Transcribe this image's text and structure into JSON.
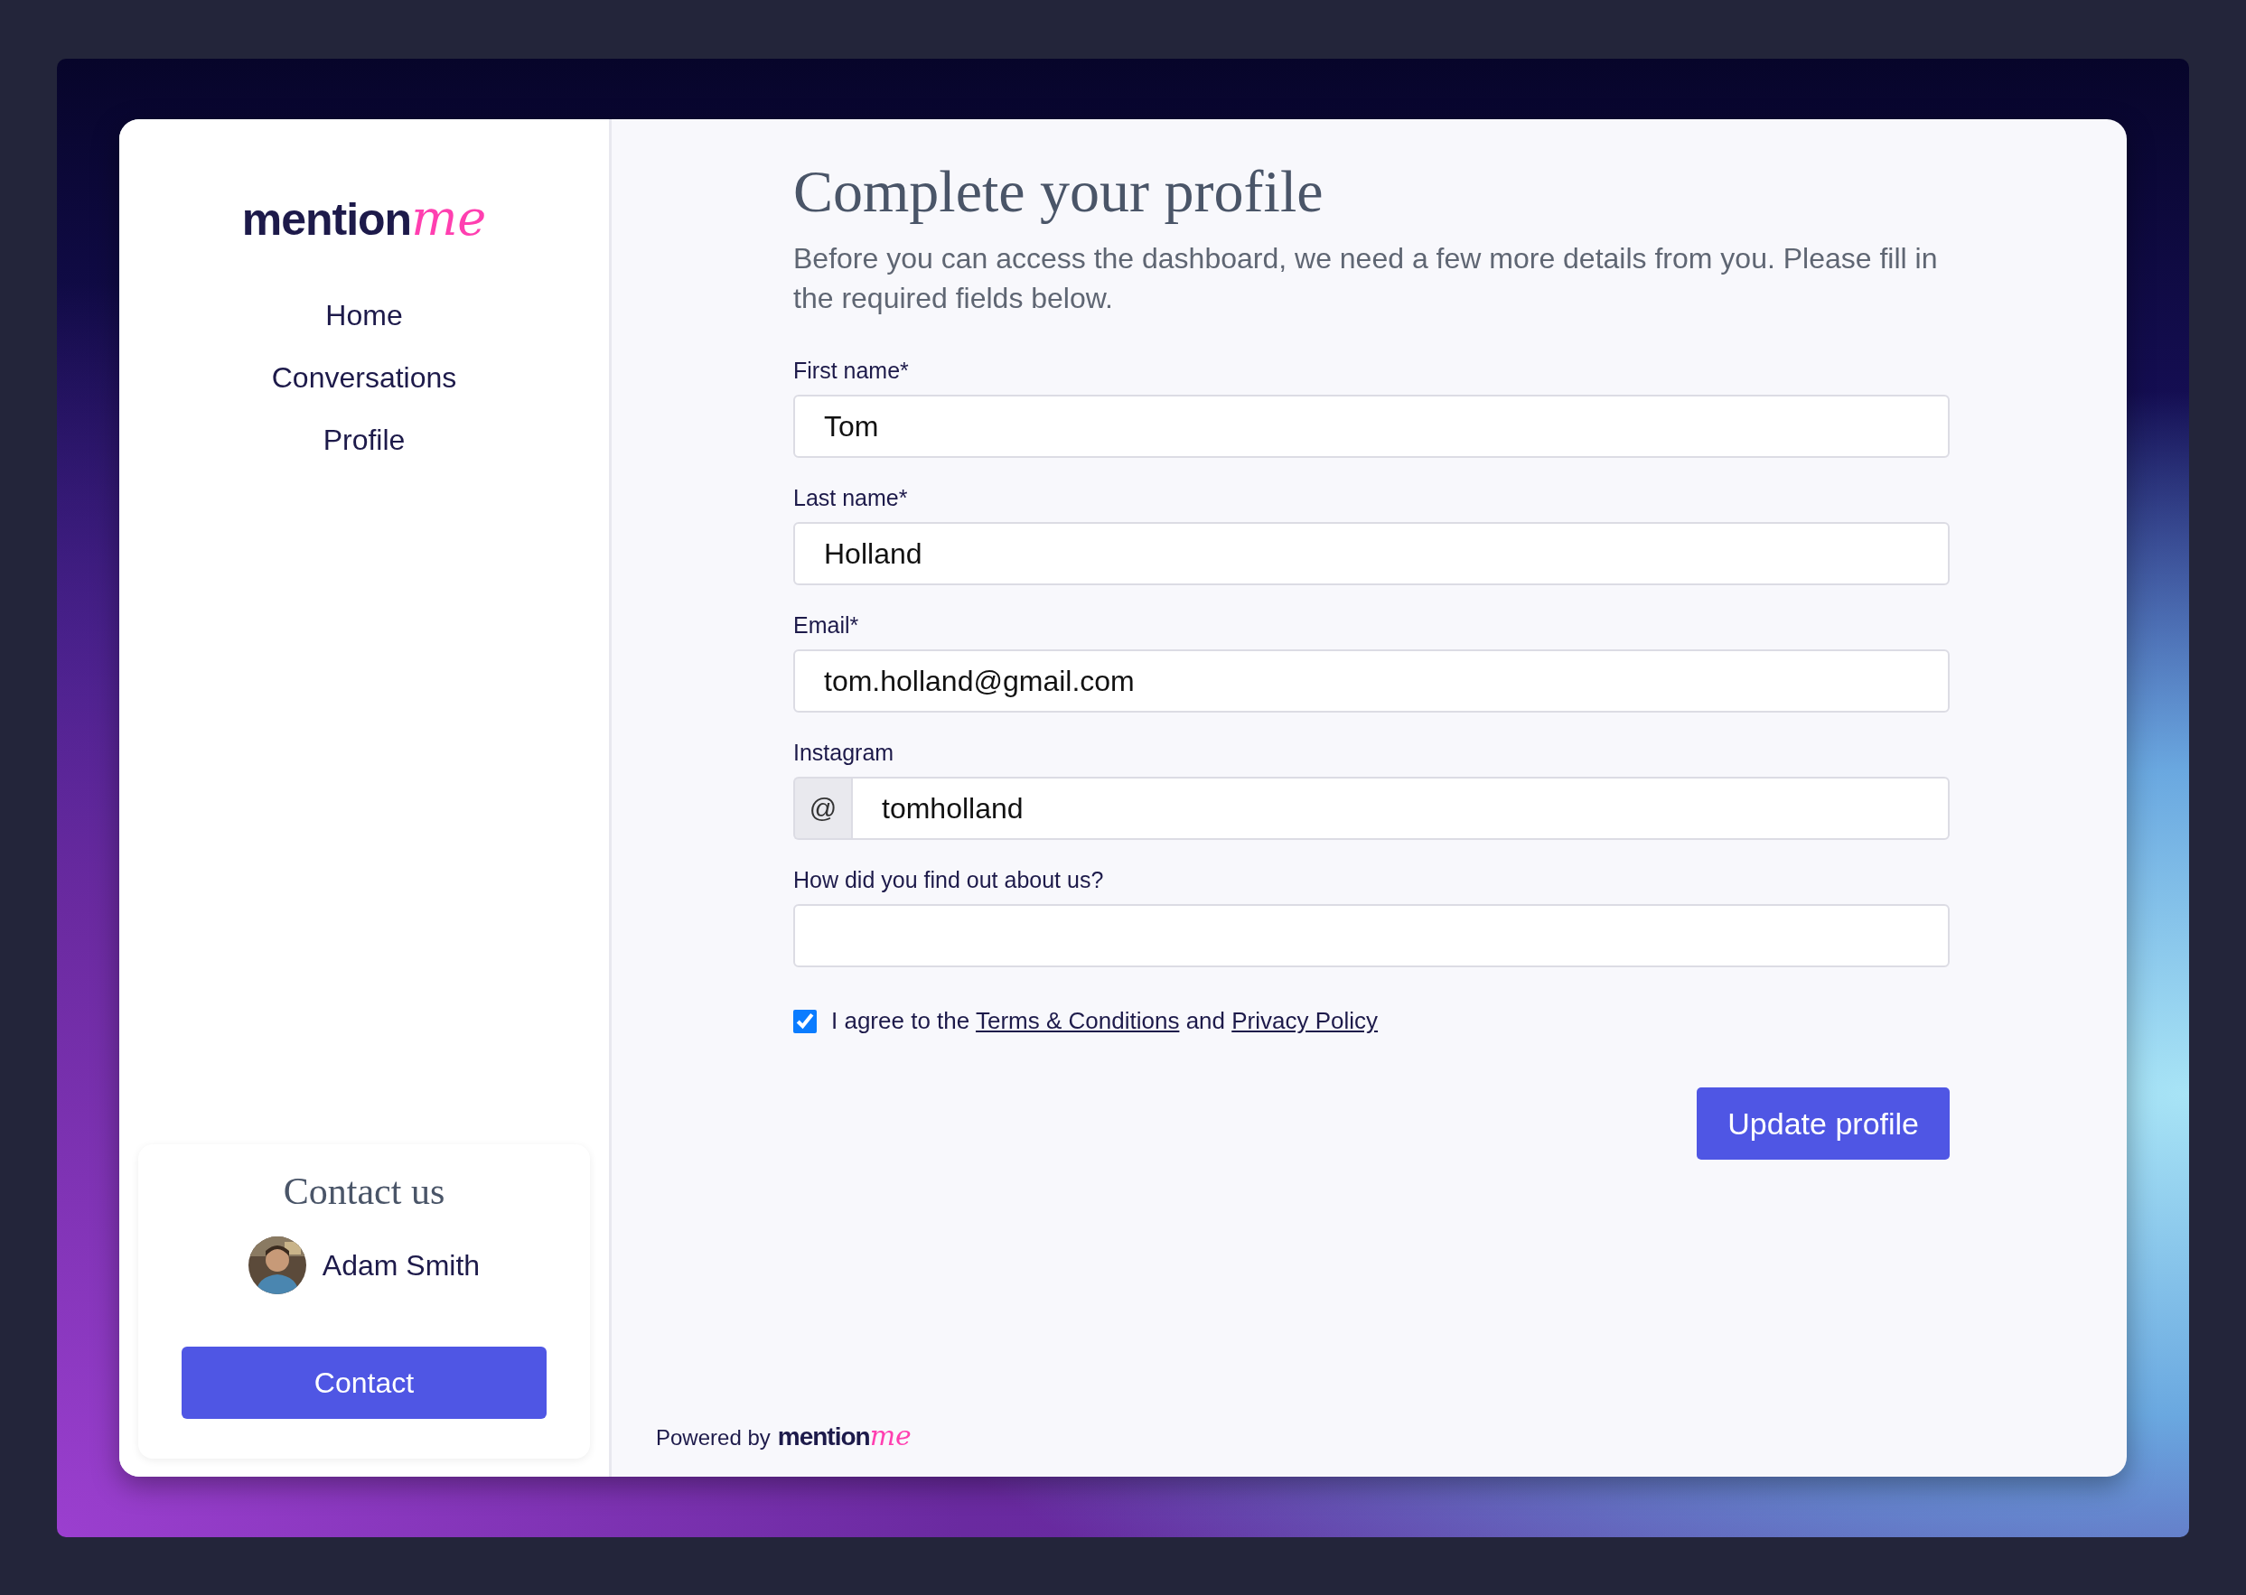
{
  "sidebar": {
    "logo": {
      "word": "mention",
      "script": "me"
    },
    "nav": [
      {
        "label": "Home"
      },
      {
        "label": "Conversations"
      },
      {
        "label": "Profile"
      }
    ],
    "contact": {
      "title": "Contact us",
      "name": "Adam Smith",
      "button": "Contact"
    }
  },
  "form": {
    "title": "Complete your profile",
    "intro": "Before you can access the dashboard, we need a few more details from you. Please fill in the required fields below.",
    "fields": [
      {
        "label": "First name*",
        "value": "Tom"
      },
      {
        "label": "Last name*",
        "value": "Holland"
      },
      {
        "label": "Email*",
        "value": "tom.holland@gmail.com"
      },
      {
        "label": "Instagram",
        "prefix": "@",
        "value": "tomholland"
      },
      {
        "label": "How did you find out about us?"
      }
    ],
    "agreement": {
      "checked": true,
      "parts": [
        {
          "kind": "text",
          "text": "I agree to the "
        },
        {
          "kind": "link",
          "text": "Terms & Conditions"
        },
        {
          "kind": "text",
          "text": " and "
        },
        {
          "kind": "link",
          "text": "Privacy Policy"
        }
      ]
    },
    "submit": "Update profile"
  },
  "footer": {
    "text": "Powered by",
    "logo": {
      "word": "mention",
      "script": "me"
    }
  }
}
